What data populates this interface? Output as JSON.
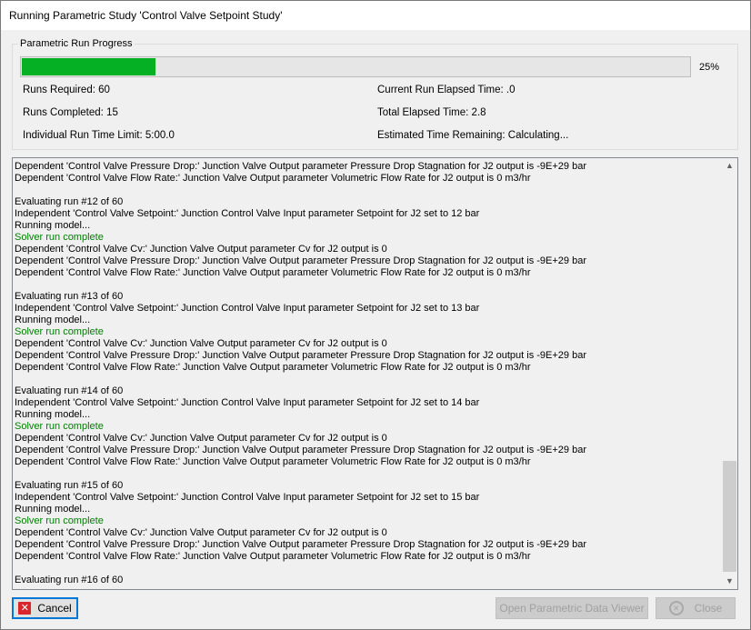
{
  "window": {
    "title": "Running Parametric Study 'Control Valve Setpoint Study'"
  },
  "progress_group": {
    "legend": "Parametric Run Progress",
    "progress_fraction": 0.2,
    "percent_label": "25%"
  },
  "stats": {
    "runs_required": "Runs Required: 60",
    "runs_completed": "Runs Completed: 15",
    "time_limit": "Individual Run Time Limit: 5:00.0",
    "current_elapsed": "Current Run Elapsed Time: .0",
    "total_elapsed": "Total Elapsed Time: 2.8",
    "estimated_remaining": "Estimated Time Remaining: Calculating..."
  },
  "log": {
    "lines": [
      {
        "text": "Dependent 'Control Valve Pressure Drop:' Junction Valve Output parameter Pressure Drop Stagnation for J2 output is -9E+29 bar",
        "status": "normal"
      },
      {
        "text": "Dependent 'Control Valve Flow Rate:' Junction Valve Output parameter Volumetric Flow Rate for J2 output is 0 m3/hr",
        "status": "normal"
      },
      {
        "text": "",
        "status": "normal"
      },
      {
        "text": "Evaluating run #12 of 60",
        "status": "normal"
      },
      {
        "text": "Independent 'Control Valve Setpoint:' Junction Control Valve Input parameter Setpoint for J2 set to 12 bar",
        "status": "normal"
      },
      {
        "text": "Running model...",
        "status": "normal"
      },
      {
        "text": "Solver run complete",
        "status": "ok"
      },
      {
        "text": "Dependent 'Control Valve Cv:' Junction Valve Output parameter Cv for J2 output is 0",
        "status": "normal"
      },
      {
        "text": "Dependent 'Control Valve Pressure Drop:' Junction Valve Output parameter Pressure Drop Stagnation for J2 output is -9E+29 bar",
        "status": "normal"
      },
      {
        "text": "Dependent 'Control Valve Flow Rate:' Junction Valve Output parameter Volumetric Flow Rate for J2 output is 0 m3/hr",
        "status": "normal"
      },
      {
        "text": "",
        "status": "normal"
      },
      {
        "text": "Evaluating run #13 of 60",
        "status": "normal"
      },
      {
        "text": "Independent 'Control Valve Setpoint:' Junction Control Valve Input parameter Setpoint for J2 set to 13 bar",
        "status": "normal"
      },
      {
        "text": "Running model...",
        "status": "normal"
      },
      {
        "text": "Solver run complete",
        "status": "ok"
      },
      {
        "text": "Dependent 'Control Valve Cv:' Junction Valve Output parameter Cv for J2 output is 0",
        "status": "normal"
      },
      {
        "text": "Dependent 'Control Valve Pressure Drop:' Junction Valve Output parameter Pressure Drop Stagnation for J2 output is -9E+29 bar",
        "status": "normal"
      },
      {
        "text": "Dependent 'Control Valve Flow Rate:' Junction Valve Output parameter Volumetric Flow Rate for J2 output is 0 m3/hr",
        "status": "normal"
      },
      {
        "text": "",
        "status": "normal"
      },
      {
        "text": "Evaluating run #14 of 60",
        "status": "normal"
      },
      {
        "text": "Independent 'Control Valve Setpoint:' Junction Control Valve Input parameter Setpoint for J2 set to 14 bar",
        "status": "normal"
      },
      {
        "text": "Running model...",
        "status": "normal"
      },
      {
        "text": "Solver run complete",
        "status": "ok"
      },
      {
        "text": "Dependent 'Control Valve Cv:' Junction Valve Output parameter Cv for J2 output is 0",
        "status": "normal"
      },
      {
        "text": "Dependent 'Control Valve Pressure Drop:' Junction Valve Output parameter Pressure Drop Stagnation for J2 output is -9E+29 bar",
        "status": "normal"
      },
      {
        "text": "Dependent 'Control Valve Flow Rate:' Junction Valve Output parameter Volumetric Flow Rate for J2 output is 0 m3/hr",
        "status": "normal"
      },
      {
        "text": "",
        "status": "normal"
      },
      {
        "text": "Evaluating run #15 of 60",
        "status": "normal"
      },
      {
        "text": "Independent 'Control Valve Setpoint:' Junction Control Valve Input parameter Setpoint for J2 set to 15 bar",
        "status": "normal"
      },
      {
        "text": "Running model...",
        "status": "normal"
      },
      {
        "text": "Solver run complete",
        "status": "ok"
      },
      {
        "text": "Dependent 'Control Valve Cv:' Junction Valve Output parameter Cv for J2 output is 0",
        "status": "normal"
      },
      {
        "text": "Dependent 'Control Valve Pressure Drop:' Junction Valve Output parameter Pressure Drop Stagnation for J2 output is -9E+29 bar",
        "status": "normal"
      },
      {
        "text": "Dependent 'Control Valve Flow Rate:' Junction Valve Output parameter Volumetric Flow Rate for J2 output is 0 m3/hr",
        "status": "normal"
      },
      {
        "text": "",
        "status": "normal"
      },
      {
        "text": "Evaluating run #16 of 60",
        "status": "normal"
      }
    ]
  },
  "buttons": {
    "cancel": {
      "label": "Cancel",
      "icon": "cancel-x-icon"
    },
    "open_viewer": {
      "label": "Open Parametric Data Viewer"
    },
    "close": {
      "label": "Close",
      "icon": "close-circle-icon"
    }
  },
  "colors": {
    "progress_fill": "#06b025",
    "solver_ok_text": "#008000",
    "cancel_icon": "#d8262c",
    "default_button_border": "#0078d7"
  }
}
